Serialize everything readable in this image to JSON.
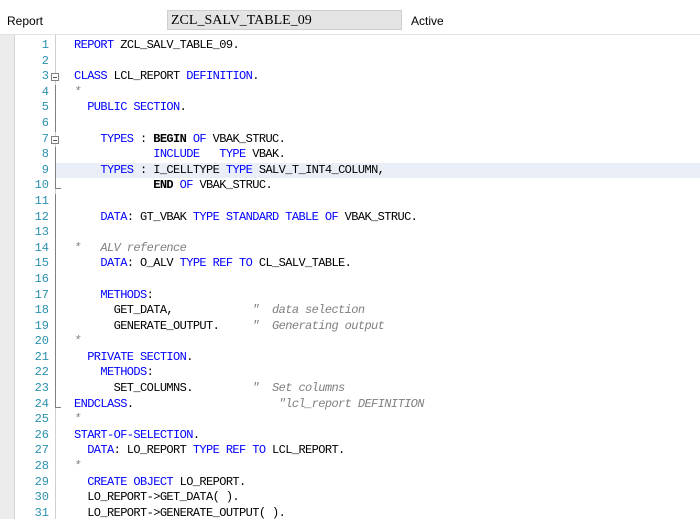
{
  "header": {
    "type_label": "Report",
    "program_name": "ZCL_SALV_TABLE_09",
    "status": "Active"
  },
  "editor": {
    "current_line": 9,
    "lines": [
      {
        "n": "1",
        "t": [
          [
            "kw",
            "REPORT "
          ],
          [
            "id",
            "ZCL_SALV_TABLE_09."
          ]
        ]
      },
      {
        "n": "2",
        "t": []
      },
      {
        "n": "3",
        "fold": "open",
        "t": [
          [
            "kw",
            "CLASS "
          ],
          [
            "id",
            "LCL_REPORT "
          ],
          [
            "kw",
            "DEFINITION"
          ],
          [
            "id",
            "."
          ]
        ]
      },
      {
        "n": "4",
        "t": [
          [
            "cm",
            "*"
          ]
        ]
      },
      {
        "n": "5",
        "t": [
          [
            "kw",
            "  PUBLIC SECTION"
          ],
          [
            "id",
            "."
          ]
        ]
      },
      {
        "n": "6",
        "t": []
      },
      {
        "n": "7",
        "fold": "open",
        "t": [
          [
            "kw",
            "    TYPES "
          ],
          [
            "id",
            ": "
          ],
          [
            "kwb",
            "BEGIN "
          ],
          [
            "kw",
            "OF "
          ],
          [
            "id",
            "VBAK_STRUC."
          ]
        ]
      },
      {
        "n": "8",
        "t": [
          [
            "kw",
            "            INCLUDE   TYPE "
          ],
          [
            "id",
            "VBAK."
          ]
        ]
      },
      {
        "n": "9",
        "t": [
          [
            "kw",
            "    TYPES "
          ],
          [
            "id",
            ": I_CELLTYPE "
          ],
          [
            "kw",
            "TYPE "
          ],
          [
            "id",
            "SALV_T_INT4_COLUMN,"
          ]
        ]
      },
      {
        "n": "10",
        "fold": "end",
        "t": [
          [
            "id",
            "            "
          ],
          [
            "kwb",
            "END "
          ],
          [
            "kw",
            "OF "
          ],
          [
            "id",
            "VBAK_STRUC."
          ]
        ]
      },
      {
        "n": "11",
        "t": []
      },
      {
        "n": "12",
        "t": [
          [
            "kw",
            "    DATA"
          ],
          [
            "id",
            ": GT_VBAK "
          ],
          [
            "kw",
            "TYPE STANDARD TABLE OF "
          ],
          [
            "id",
            "VBAK_STRUC."
          ]
        ]
      },
      {
        "n": "13",
        "t": []
      },
      {
        "n": "14",
        "t": [
          [
            "cm",
            "*   ALV reference"
          ]
        ]
      },
      {
        "n": "15",
        "t": [
          [
            "kw",
            "    DATA"
          ],
          [
            "id",
            ": O_ALV "
          ],
          [
            "kw",
            "TYPE REF TO "
          ],
          [
            "id",
            "CL_SALV_TABLE."
          ]
        ]
      },
      {
        "n": "16",
        "t": []
      },
      {
        "n": "17",
        "t": [
          [
            "kw",
            "    METHODS"
          ],
          [
            "id",
            ":"
          ]
        ]
      },
      {
        "n": "18",
        "t": [
          [
            "id",
            "      GET_DATA,            "
          ],
          [
            "cm",
            "\"  data selection"
          ]
        ]
      },
      {
        "n": "19",
        "t": [
          [
            "id",
            "      GENERATE_OUTPUT.     "
          ],
          [
            "cm",
            "\"  Generating output"
          ]
        ]
      },
      {
        "n": "20",
        "t": [
          [
            "cm",
            "*"
          ]
        ]
      },
      {
        "n": "21",
        "t": [
          [
            "kw",
            "  PRIVATE SECTION"
          ],
          [
            "id",
            "."
          ]
        ]
      },
      {
        "n": "22",
        "t": [
          [
            "kw",
            "    METHODS"
          ],
          [
            "id",
            ":"
          ]
        ]
      },
      {
        "n": "23",
        "t": [
          [
            "id",
            "      SET_COLUMNS.         "
          ],
          [
            "cm",
            "\"  Set columns"
          ]
        ]
      },
      {
        "n": "24",
        "fold": "end",
        "t": [
          [
            "kw",
            "ENDCLASS"
          ],
          [
            "id",
            ".                      "
          ],
          [
            "cm",
            "\"lcl_report DEFINITION"
          ]
        ]
      },
      {
        "n": "25",
        "t": [
          [
            "cm",
            "*"
          ]
        ]
      },
      {
        "n": "26",
        "t": [
          [
            "kw",
            "START-OF-SELECTION"
          ],
          [
            "id",
            "."
          ]
        ]
      },
      {
        "n": "27",
        "t": [
          [
            "kw",
            "  DATA"
          ],
          [
            "id",
            ": LO_REPORT "
          ],
          [
            "kw",
            "TYPE REF TO "
          ],
          [
            "id",
            "LCL_REPORT."
          ]
        ]
      },
      {
        "n": "28",
        "t": [
          [
            "cm",
            "*"
          ]
        ]
      },
      {
        "n": "29",
        "t": [
          [
            "kw",
            "  CREATE OBJECT "
          ],
          [
            "id",
            "LO_REPORT."
          ]
        ]
      },
      {
        "n": "30",
        "t": [
          [
            "id",
            "  LO_REPORT->GET_DATA( )."
          ]
        ]
      },
      {
        "n": "31",
        "t": [
          [
            "id",
            "  LO_REPORT->GENERATE_OUTPUT( )."
          ]
        ]
      }
    ]
  },
  "colors": {
    "keyword": "#0000ff",
    "comment": "#808080",
    "line_number": "#2b91af",
    "current_line_bg": "#e9eef7"
  }
}
